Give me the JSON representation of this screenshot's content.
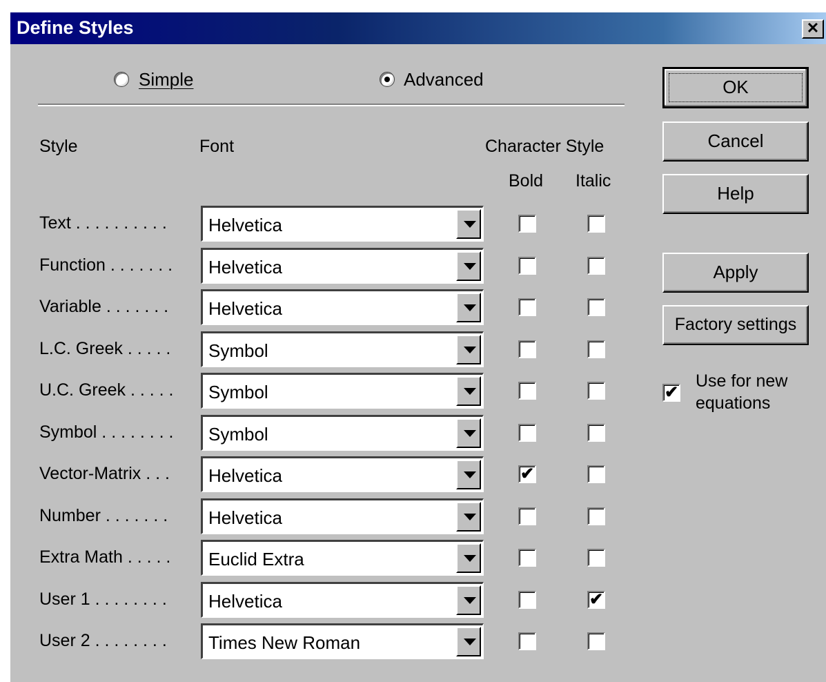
{
  "window": {
    "title": "Define Styles",
    "close_glyph": "✕"
  },
  "mode": {
    "simple_label": "Simple",
    "advanced_label": "Advanced",
    "selected": "advanced"
  },
  "headers": {
    "style": "Style",
    "font": "Font",
    "character_style": "Character Style",
    "bold": "Bold",
    "italic": "Italic"
  },
  "rows": [
    {
      "label": "Text . . . . . . . . . .",
      "font": "Helvetica",
      "bold": false,
      "italic": false
    },
    {
      "label": "Function . . . . . . .",
      "font": "Helvetica",
      "bold": false,
      "italic": false
    },
    {
      "label": "Variable . . . . . . .",
      "font": "Helvetica",
      "bold": false,
      "italic": false
    },
    {
      "label": "L.C. Greek . . . . .",
      "font": "Symbol",
      "bold": false,
      "italic": false
    },
    {
      "label": "U.C. Greek . . . . .",
      "font": "Symbol",
      "bold": false,
      "italic": false
    },
    {
      "label": "Symbol . . . . . . . .",
      "font": "Symbol",
      "bold": false,
      "italic": false
    },
    {
      "label": "Vector-Matrix . . .",
      "font": "Helvetica",
      "bold": true,
      "italic": false
    },
    {
      "label": "Number . . . . . . .",
      "font": "Helvetica",
      "bold": false,
      "italic": false
    },
    {
      "label": "Extra Math . . . . .",
      "font": "Euclid Extra",
      "bold": false,
      "italic": false
    },
    {
      "label": "User 1 . . . . . . . .",
      "font": "Helvetica",
      "bold": false,
      "italic": true
    },
    {
      "label": "User 2 . . . . . . . .",
      "font": "Times New Roman",
      "bold": false,
      "italic": false
    }
  ],
  "buttons": {
    "ok": "OK",
    "cancel": "Cancel",
    "help": "Help",
    "apply": "Apply",
    "factory": "Factory settings"
  },
  "use_for_new": {
    "label_line1": "Use for new",
    "label_line2": "equations",
    "checked": true
  },
  "check_glyph": "✔"
}
